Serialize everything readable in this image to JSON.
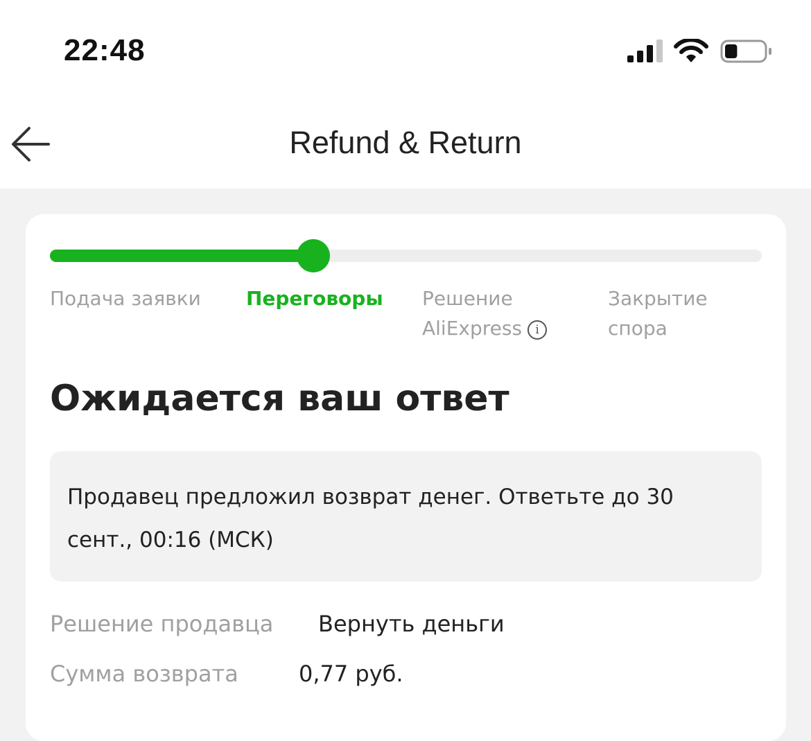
{
  "status_bar": {
    "time": "22:48",
    "battery_level": 0.3
  },
  "header": {
    "title": "Refund & Return",
    "back_icon": "arrow-left-icon"
  },
  "progress": {
    "current_step": 1,
    "fraction": 0.37,
    "accent_color": "#19b21f",
    "steps": [
      {
        "label": "Подача заявки"
      },
      {
        "label": "Переговоры"
      },
      {
        "label_line1": "Решение",
        "label_line2": "AliExpress",
        "info_icon": "info-icon"
      },
      {
        "label_line1": "Закрытие",
        "label_line2": "спора"
      }
    ]
  },
  "main": {
    "heading": "Ожидается ваш ответ",
    "notice": "Продавец предложил возврат денег. Ответьте до 30 сент., 00:16 (МСК)",
    "details": [
      {
        "label": "Решение продавца",
        "value": "Вернуть деньги"
      },
      {
        "label": "Сумма возврата",
        "value": "0,77 руб."
      }
    ]
  }
}
